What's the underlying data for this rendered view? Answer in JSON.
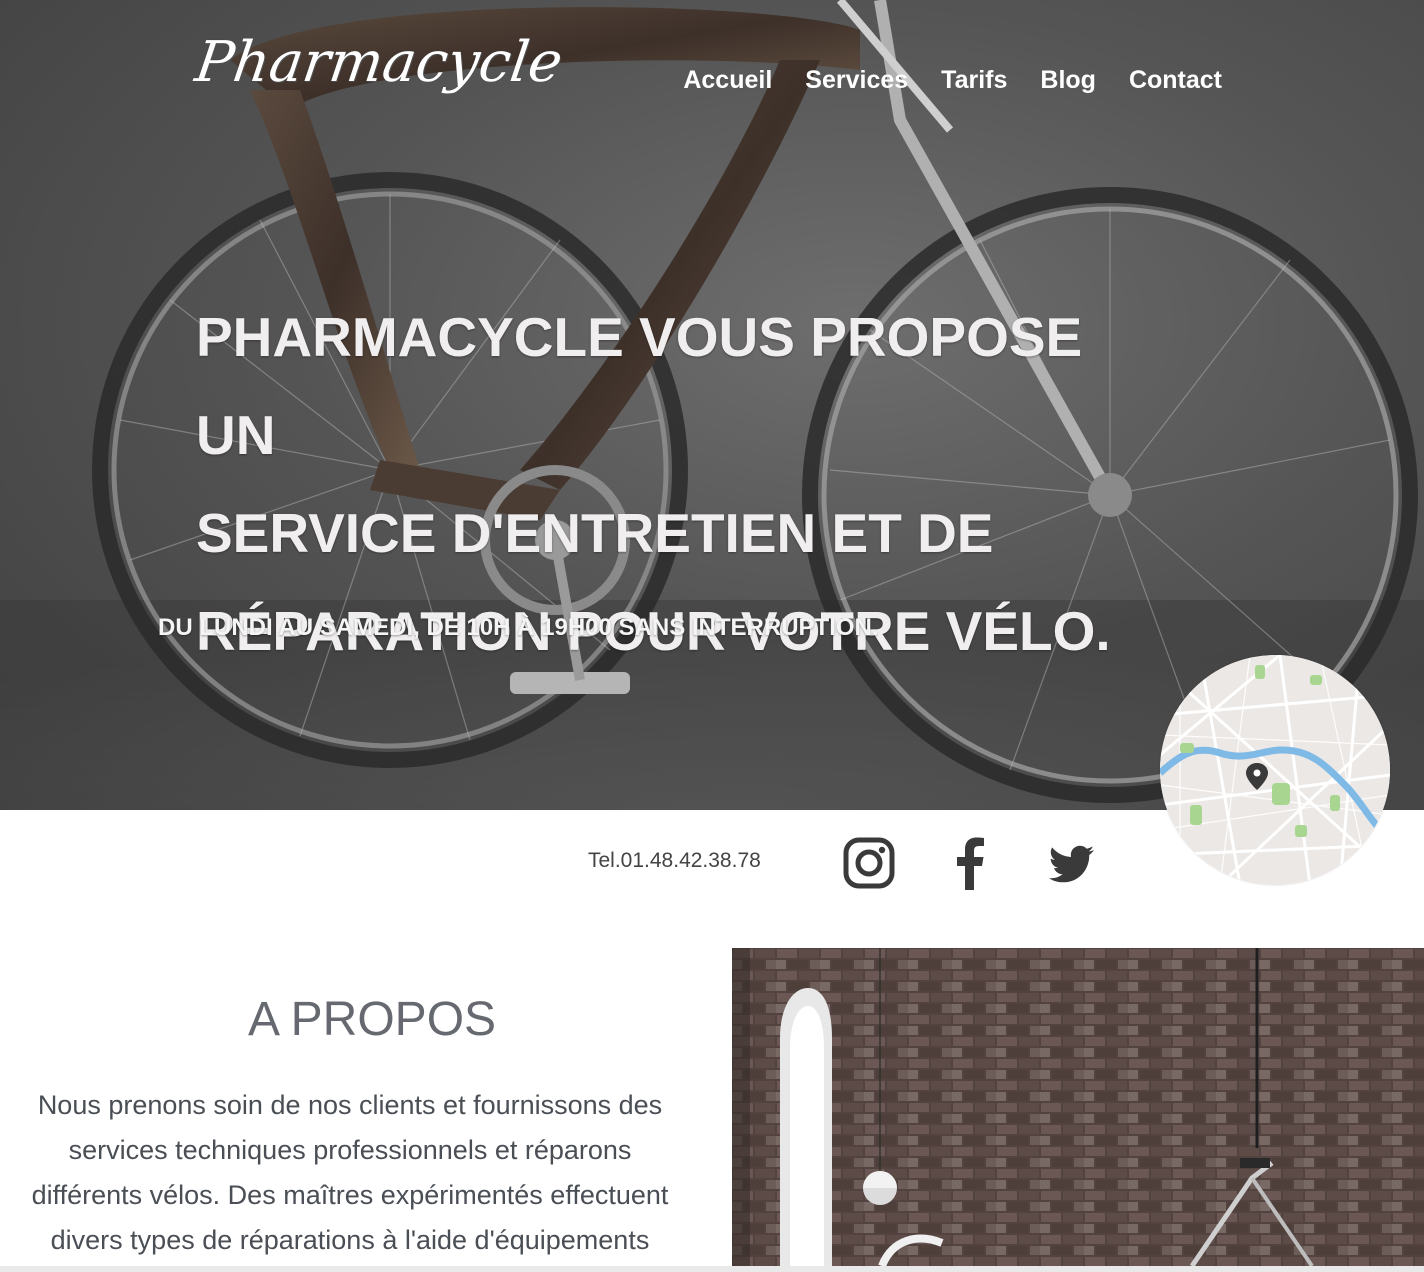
{
  "header": {
    "logo_text": "Pharmacycle",
    "nav": [
      {
        "label": "Accueil"
      },
      {
        "label": "Services"
      },
      {
        "label": "Tarifs"
      },
      {
        "label": "Blog"
      },
      {
        "label": "Contact"
      }
    ]
  },
  "hero": {
    "headline_lines": [
      "PHARMACYCLE VOUS PROPOSE UN",
      "SERVICE D'ENTRETIEN ET DE",
      "RÉPARATION POUR VOTRE VÉLO."
    ],
    "hours": "DU LUNDI AU SAMEDI, DE 10H À 19H00 SANS INTERRUPTION."
  },
  "contact": {
    "phone": "Tel.01.48.42.38.78",
    "social_icons": [
      "instagram-icon",
      "facebook-icon",
      "twitter-icon"
    ]
  },
  "about": {
    "title": "A PROPOS",
    "text": "Nous prenons soin de nos clients et fournissons des services techniques professionnels et réparons différents vélos. Des maîtres expérimentés effectuent divers types de réparations à l'aide d'équipements"
  },
  "colors": {
    "hero_text": "#f0eeee",
    "icon": "#3a3a3a",
    "about_title": "#666a70",
    "about_text": "#4a4e55",
    "map_river": "#7fb9e6",
    "map_park": "#a8d590"
  }
}
